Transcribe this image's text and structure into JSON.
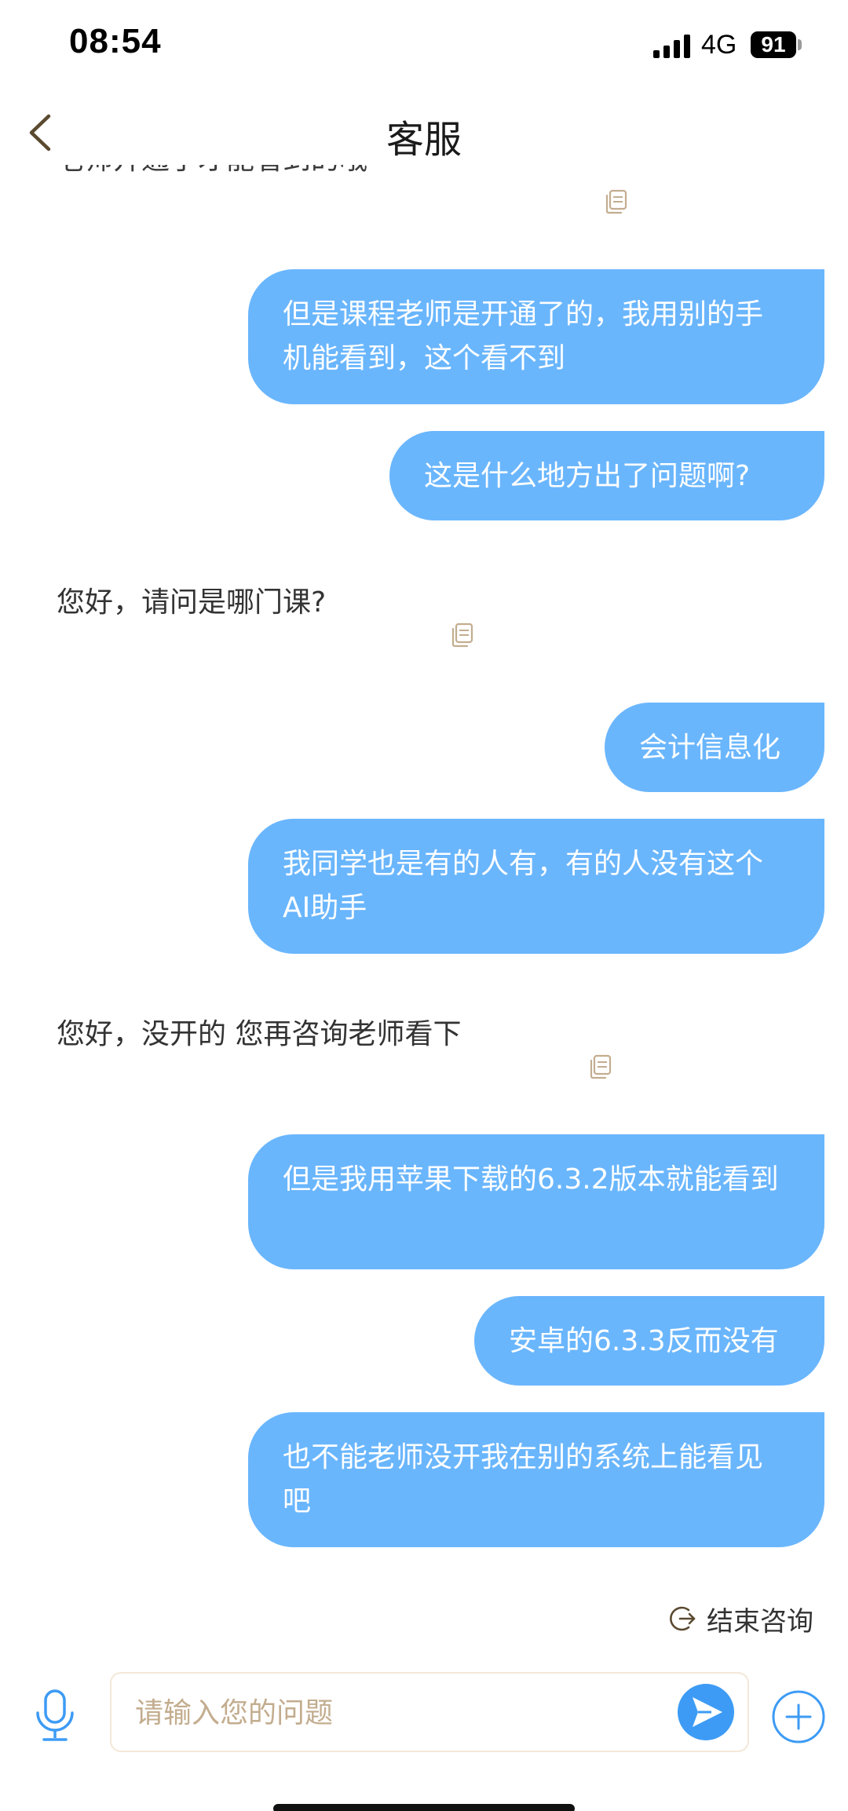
{
  "status_bar": {
    "time": "08:54",
    "network": "4G",
    "battery": "91"
  },
  "header": {
    "title": "客服"
  },
  "messages": [
    {
      "from": "agent",
      "text": "您好，请问是哪门课?"
    },
    {
      "from": "user",
      "text": "但是课程老师是开通了的，我用别的手机能看到，这个看不到"
    },
    {
      "from": "user",
      "text": "这是什么地方出了问题啊?"
    },
    {
      "from": "user",
      "text": "会计信息化"
    },
    {
      "from": "user",
      "text": "我同学也是有的人有，有的人没有这个AI助手"
    },
    {
      "from": "agent",
      "text": "您好，没开的 您再咨询老师看下"
    },
    {
      "from": "user",
      "text": "但是我用苹果下载的6.3.2版本就能看到"
    },
    {
      "from": "user",
      "text": "安卓的6.3.3反而没有"
    },
    {
      "from": "user",
      "text": "也不能老师没开我在别的系统上能看见吧"
    }
  ],
  "end_consult": {
    "label": "结束咨询"
  },
  "composer": {
    "placeholder": "请输入您的问题"
  },
  "colors": {
    "user_bubble": "#6ab6fd",
    "accent_gold": "#c3ad8f",
    "send_button": "#3d9bf5"
  },
  "icons": {
    "back": "chevron-left-icon",
    "copy": "copy-icon",
    "mic": "microphone-icon",
    "send": "send-icon",
    "plus": "plus-circle-icon",
    "end": "exit-icon"
  }
}
